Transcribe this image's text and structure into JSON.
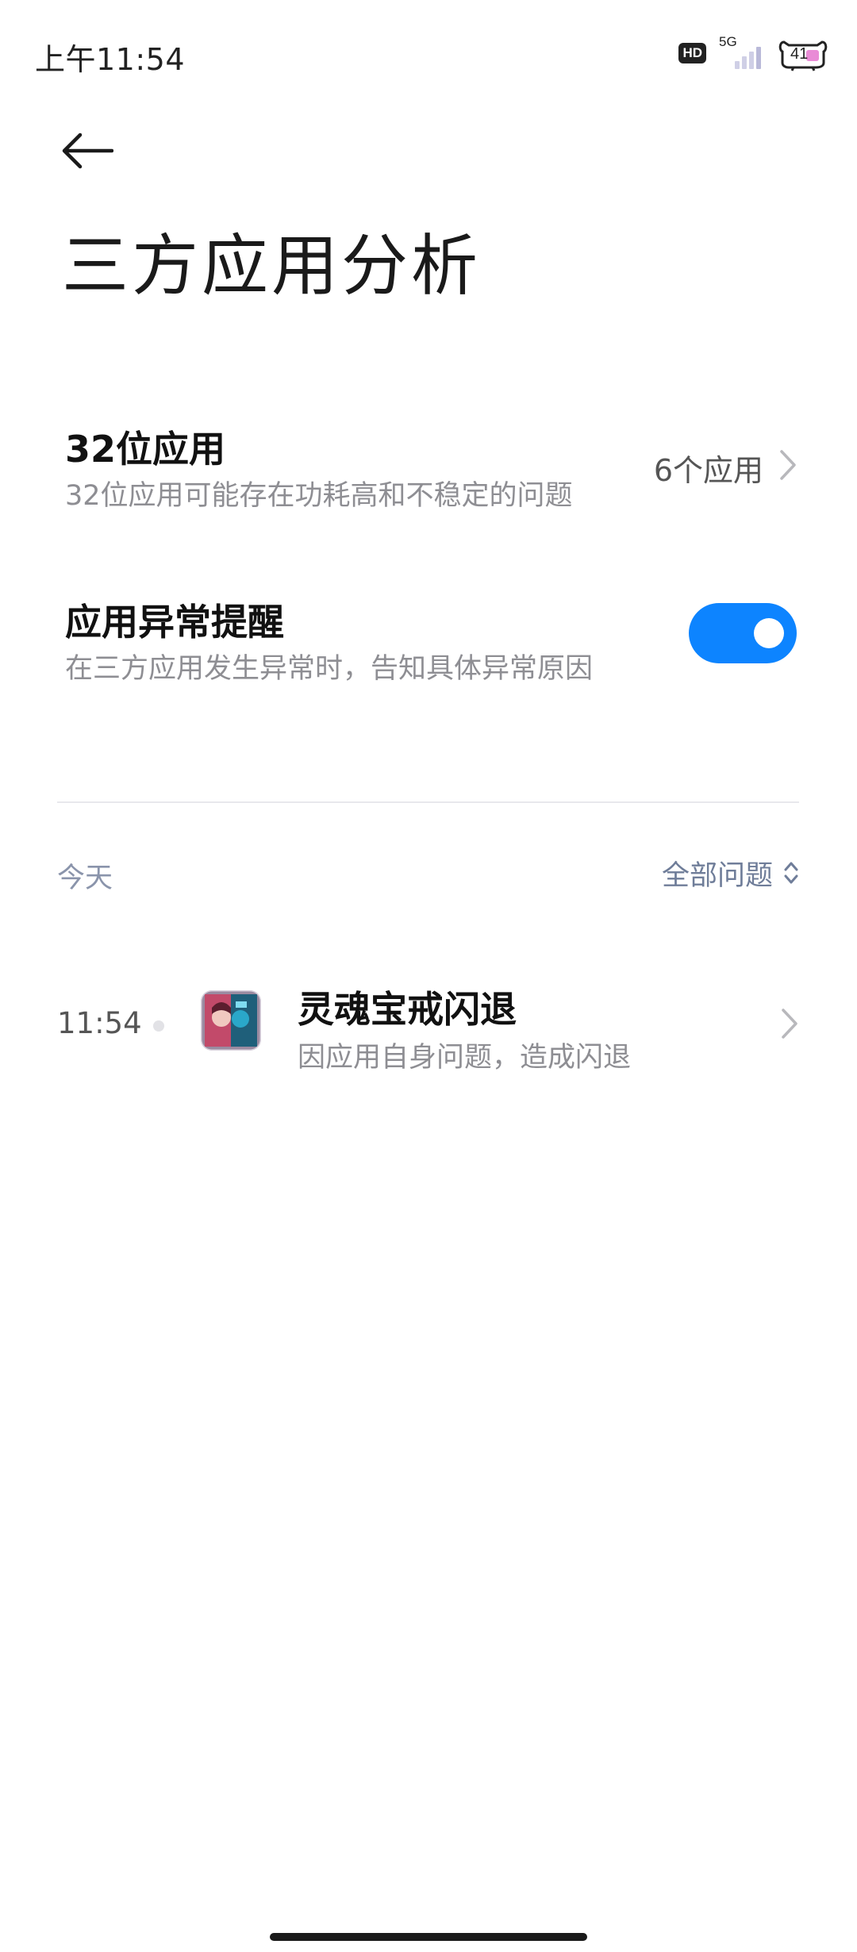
{
  "status_bar": {
    "time": "上午11:54",
    "hd_badge": "HD",
    "network_type": "5G",
    "battery_level": "41"
  },
  "header": {
    "back_icon": "arrow-left-icon",
    "title": "三方应用分析"
  },
  "settings": {
    "bit32": {
      "title": "32位应用",
      "subtitle": "32位应用可能存在功耗高和不稳定的问题",
      "value": "6个应用"
    },
    "abnormal_alert": {
      "title": "应用异常提醒",
      "subtitle": "在三方应用发生异常时，告知具体异常原因",
      "enabled": true
    }
  },
  "event_list": {
    "section_label": "今天",
    "filter_label": "全部问题",
    "items": [
      {
        "time": "11:54",
        "title": "灵魂宝戒闪退",
        "subtitle": "因应用自身问题，造成闪退"
      }
    ]
  },
  "colors": {
    "accent": "#0d84ff",
    "secondary_text": "#8e8e93",
    "section_text": "#8a94ab"
  }
}
